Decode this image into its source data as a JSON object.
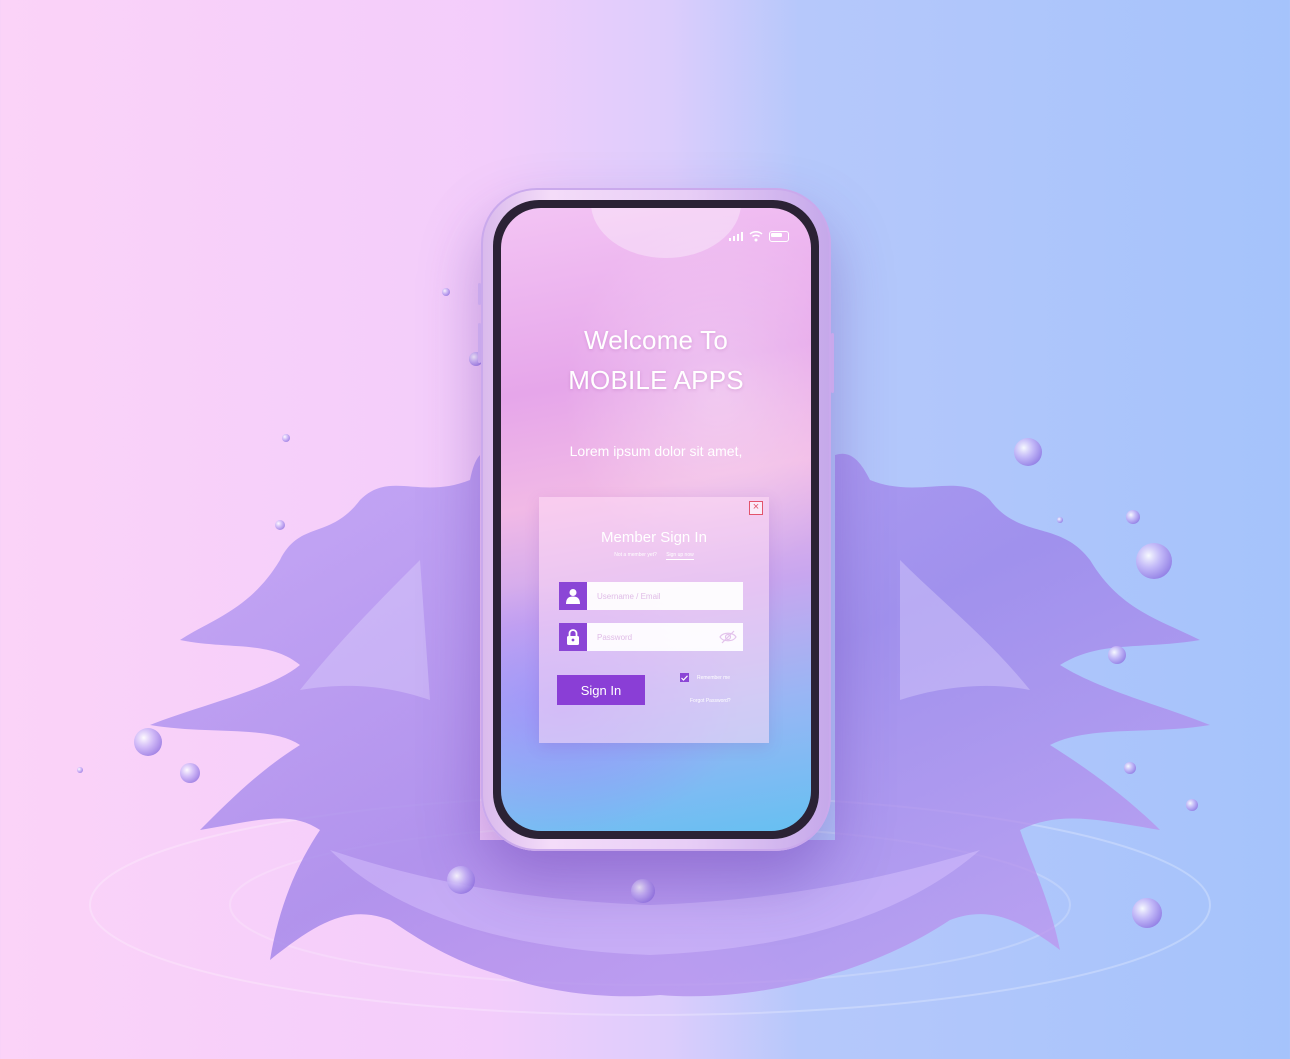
{
  "status_bar": {
    "signal_icon": "signal-bars-icon",
    "wifi_icon": "wifi-icon",
    "battery_icon": "battery-icon"
  },
  "welcome": {
    "title_line1": "Welcome To",
    "title_line2": "MOBILE APPS",
    "subtitle": "Lorem ipsum dolor sit amet,"
  },
  "signin_card": {
    "title": "Member Sign In",
    "not_member_text": "Not a member yet?",
    "signup_link": "Sign up now",
    "username_placeholder": "Username / Email",
    "password_placeholder": "Password",
    "signin_button": "Sign In",
    "remember_label": "Remember me",
    "remember_checked": true,
    "forgot_link": "Forgot Password?",
    "close_icon": "close-icon",
    "user_icon": "user-icon",
    "lock_icon": "lock-icon",
    "eye_icon": "eye-off-icon"
  },
  "colors": {
    "accent": "#8a3ed6",
    "close": "#e2546c"
  }
}
